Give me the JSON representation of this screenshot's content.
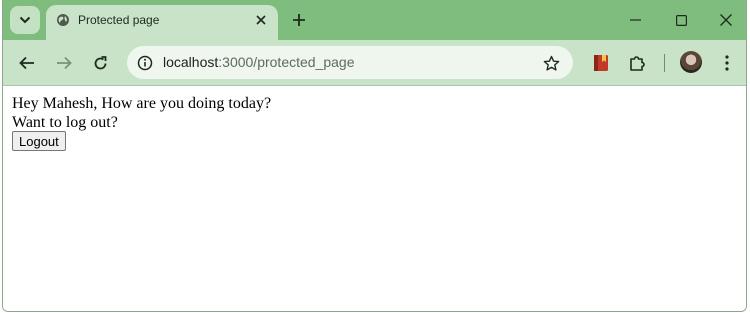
{
  "tab": {
    "title": "Protected page",
    "favicon": "globe-icon"
  },
  "address_bar": {
    "host": "localhost",
    "path": ":3000/protected_page"
  },
  "page": {
    "greeting": "Hey Mahesh, How are you doing today?",
    "question": "Want to log out?",
    "logout_label": "Logout"
  },
  "colors": {
    "tabstrip": "#7fbd7e",
    "toolbar": "#c8e3c7",
    "omnibox": "#eef6ee"
  },
  "icons": [
    "tab-search-icon",
    "globe-icon",
    "close-icon",
    "plus-icon",
    "minimize-icon",
    "maximize-icon",
    "window-close-icon",
    "back-icon",
    "forward-icon",
    "reload-icon",
    "site-info-icon",
    "star-icon",
    "bookmark-extension-icon",
    "puzzle-icon",
    "avatar",
    "menu-icon"
  ]
}
